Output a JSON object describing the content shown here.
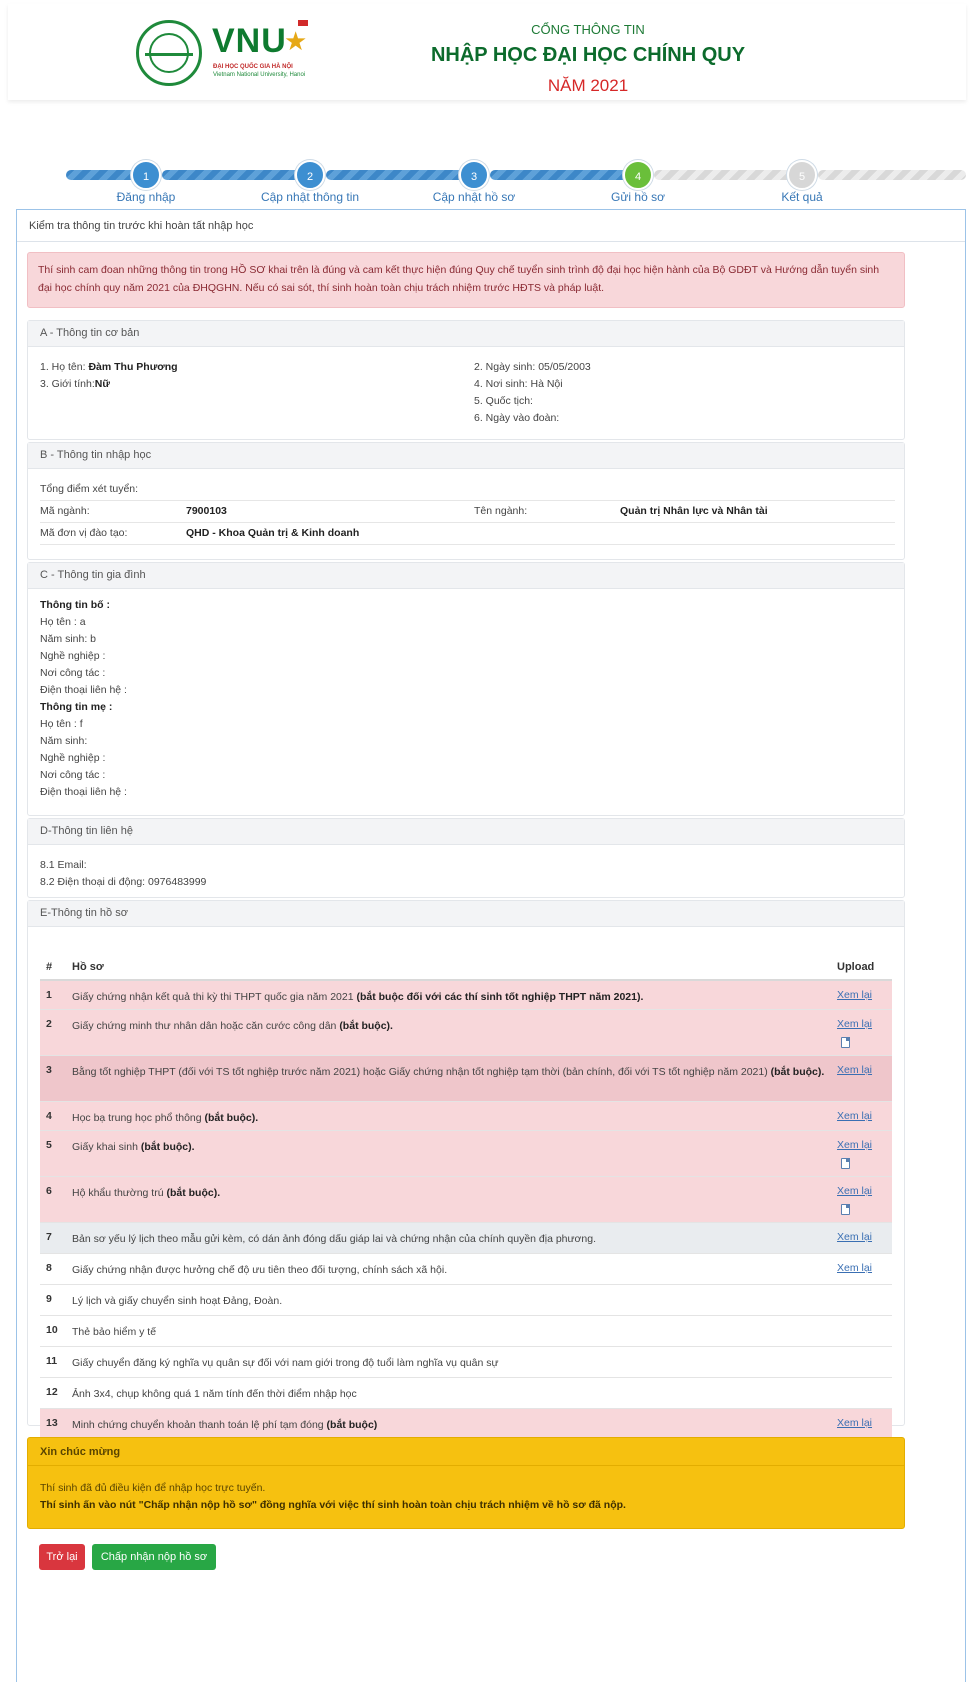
{
  "header": {
    "logo_text": "VNU",
    "logo_sub1": "ĐẠI HỌC QUỐC GIA HÀ NỘI",
    "logo_sub2": "Vietnam National University, Hanoi",
    "portal_small": "CỔNG THÔNG TIN",
    "portal_title": "NHẬP HỌC ĐẠI HỌC CHÍNH QUY",
    "portal_year": "NĂM 2021"
  },
  "stepper": {
    "steps": [
      {
        "number": "1",
        "label": "Đăng nhập"
      },
      {
        "number": "2",
        "label": "Cập nhật thông tin"
      },
      {
        "number": "3",
        "label": "Cập nhật hồ sơ"
      },
      {
        "number": "4",
        "label": "Gửi hồ sơ"
      },
      {
        "number": "5",
        "label": "Kết quả"
      }
    ],
    "current_step": 4
  },
  "panel": {
    "title": "Kiểm tra thông tin trước khi hoàn tất nhập học",
    "commitment": "Thí sinh cam đoan những thông tin trong HỒ SƠ khai trên là đúng và cam kết thực hiện đúng Quy chế tuyển sinh trình độ đại học hiện hành của Bộ GDĐT và Hướng dẫn tuyển sinh đại học chính quy năm 2021 của ĐHQGHN. Nếu có sai sót, thí sinh hoàn toàn chịu trách nhiệm trước HĐTS và pháp luật."
  },
  "section_a": {
    "title": "A - Thông tin cơ bản",
    "name_label": "1. Họ tên: ",
    "name_value": "Đàm Thu Phương",
    "gender_label": "3. Giới tính:",
    "gender_value": "Nữ",
    "dob": "2. Ngày sinh: 05/05/2003",
    "birthplace": "4. Nơi sinh: Hà Nội",
    "nationality": "5. Quốc tịch:",
    "union_date": "6. Ngày vào đoàn:"
  },
  "section_b": {
    "title": "B - Thông tin nhập học",
    "total_score_label": "Tổng điểm xét tuyển:",
    "major_code_label": "Mã ngành:",
    "major_code_value": "7900103",
    "major_name_label": "Tên ngành:",
    "major_name_value": "Quản trị Nhân lực và Nhân tài",
    "unit_label": "Mã đơn vị đào tạo:",
    "unit_value": "QHD - Khoa Quản trị & Kinh doanh"
  },
  "section_c": {
    "title": "C - Thông tin gia đình",
    "father_heading": "Thông tin bố :",
    "father_name": "Họ tên : a",
    "father_birth": "Năm sinh: b",
    "father_job": "Nghề nghiệp :",
    "father_work": "Nơi công tác :",
    "father_phone": "Điện thoại liên hệ :",
    "mother_heading": "Thông tin mẹ :",
    "mother_name": "Họ tên : f",
    "mother_birth": "Năm sinh:",
    "mother_job": "Nghề nghiệp :",
    "mother_work": "Nơi công tác :",
    "mother_phone": "Điện thoại liên hệ :"
  },
  "section_d": {
    "title": "D-Thông tin liên hệ",
    "email": "8.1 Email:",
    "phone": "8.2 Điện thoại di động: 0976483999"
  },
  "section_e": {
    "title": "E-Thông tin hồ sơ",
    "col_num": "#",
    "col_doc": "Hồ sơ",
    "col_upload": "Upload",
    "view_label": "Xem lại",
    "rows": [
      {
        "num": "1",
        "text": "Giấy chứng nhận kết quả thi kỳ thi THPT quốc gia năm 2021 ",
        "bold": "(bắt buộc đối với các thí sinh tốt nghiệp THPT năm 2021)."
      },
      {
        "num": "2",
        "text": "Giấy chứng minh thư nhân dân hoặc căn cước công dân ",
        "bold": "(bắt buộc)."
      },
      {
        "num": "3",
        "text": "Bằng tốt nghiệp THPT (đối với TS tốt nghiệp trước năm 2021) hoặc Giấy chứng nhận tốt nghiệp tạm thời (bản chính, đối với TS tốt nghiệp năm 2021) ",
        "bold": "(bắt buộc)."
      },
      {
        "num": "4",
        "text": "Học bạ trung học phổ thông ",
        "bold": "(bắt buộc)."
      },
      {
        "num": "5",
        "text": "Giấy khai sinh ",
        "bold": "(bắt buộc)."
      },
      {
        "num": "6",
        "text": "Hộ khẩu thường trú ",
        "bold": "(bắt buộc)."
      },
      {
        "num": "7",
        "text": "Bản sơ yếu lý lịch theo mẫu gửi kèm, có dán ảnh đóng dấu giáp lai và chứng nhận của chính quyền địa phương.",
        "bold": ""
      },
      {
        "num": "8",
        "text": "Giấy chứng nhận được hưởng chế độ ưu tiên theo đối tượng, chính sách xã hội.",
        "bold": ""
      },
      {
        "num": "9",
        "text": "Lý lịch và giấy chuyển sinh hoạt Đảng, Đoàn.",
        "bold": ""
      },
      {
        "num": "10",
        "text": "Thẻ bảo hiểm y tế",
        "bold": ""
      },
      {
        "num": "11",
        "text": "Giấy chuyển đăng ký nghĩa vụ quân sự đối với nam giới trong độ tuổi làm nghĩa vụ quân sự",
        "bold": ""
      },
      {
        "num": "12",
        "text": "Ảnh 3x4, chụp không quá 1 năm tính đến thời điểm nhập học",
        "bold": ""
      },
      {
        "num": "13",
        "text": "Minh chứng chuyển khoản thanh toán lệ phí tạm đóng ",
        "bold": "(bắt buộc)"
      }
    ]
  },
  "congrats": {
    "title": "Xin chúc mừng",
    "line1": "Thí sinh đã đủ điều kiện để nhập học trực tuyến.",
    "line2": "Thí sinh ấn vào nút \"Chấp nhận nộp hồ sơ\" đồng nghĩa với việc thí sinh hoàn toàn chịu trách nhiệm về hồ sơ đã nộp."
  },
  "buttons": {
    "back": "Trở lại",
    "accept": "Chấp nhận nộp hồ sơ"
  },
  "colors": {
    "brand_green": "#0c6b2c",
    "step_blue": "#3d8fd1",
    "step_active": "#6abf3a",
    "alert_red_bg": "#f8d7da",
    "alert_yellow_bg": "#f6c110",
    "btn_back": "#d9363e",
    "btn_accept": "#28a745"
  }
}
